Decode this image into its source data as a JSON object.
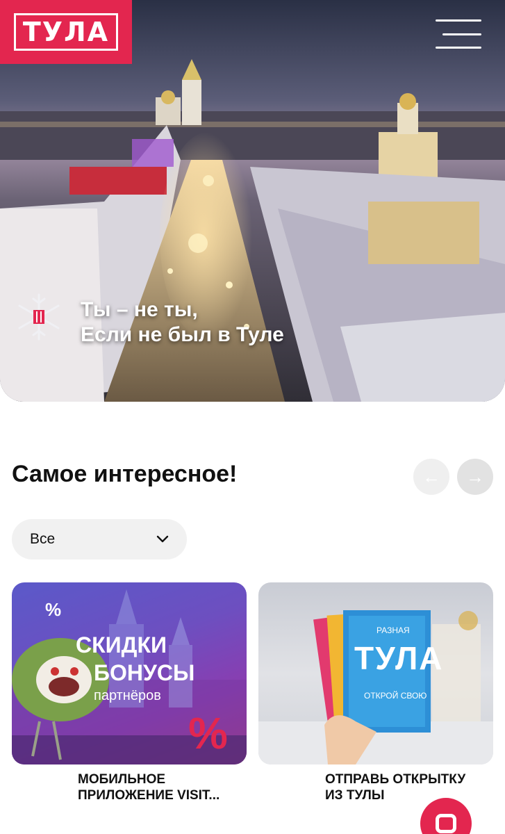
{
  "header": {
    "logo_text": "ТУЛА",
    "menu_icon": "burger-menu-icon"
  },
  "hero": {
    "tagline_line1": "Ты – не ты,",
    "tagline_line2": "Если не был в Туле",
    "badge_icon": "snowflake-icon"
  },
  "section": {
    "title": "Самое интересное!",
    "prev_icon": "arrow-left-icon",
    "next_icon": "arrow-right-icon"
  },
  "filter": {
    "value": "Все",
    "icon": "chevron-down-icon"
  },
  "cards": [
    {
      "title_line1": "МОБИЛЬНОЕ",
      "title_line2": "ПРИЛОЖЕНИЕ VISIT...",
      "promo_line1": "СКИДКИ",
      "promo_line2": "БОНУСЫ",
      "promo_line3": "партнёров",
      "percent": "%"
    },
    {
      "title_line1": "ОТПРАВЬ ОТКРЫТКУ",
      "title_line2": "ИЗ ТУЛЫ",
      "postcard_top": "РАЗНАЯ",
      "postcard_main": "ТУЛА",
      "postcard_bottom": "ОТКРОЙ СВОЮ"
    }
  ],
  "chat": {
    "icon": "chat-icon"
  },
  "colors": {
    "brand": "#e3264f",
    "chip_bg": "#f1f1f1",
    "nav_bg": "#e7e7e7"
  }
}
